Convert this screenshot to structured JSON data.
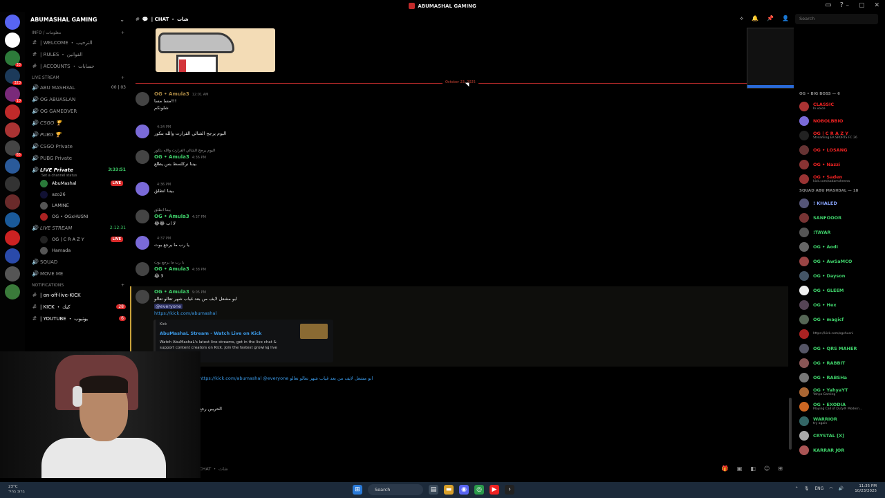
{
  "window": {
    "title": "ABUMASHAL GAMING",
    "search_placeholder": "Search"
  },
  "server": {
    "name": "ABUMASHAL GAMING"
  },
  "categories": {
    "info": "INFO / معلومات",
    "live": "LIVE STREAM",
    "notifications": "NOTIFICATIONS"
  },
  "channels": [
    {
      "label": "| WELCOME ・ الترحيب",
      "icon": "👋"
    },
    {
      "label": "| RULES ・ القوانين",
      "icon": "📄"
    },
    {
      "label": "| ACCOUNTS ・ حسابات",
      "icon": "🔗"
    },
    {
      "label": "ABU MASH3AL",
      "meta": "00 | 03"
    },
    {
      "label": "OG ABUASLAN",
      "meta": ""
    },
    {
      "label": "OG GAMEOVER",
      "meta": ""
    },
    {
      "label": "CSGO 🏆",
      "meta": ""
    },
    {
      "label": "PUBG 🏆",
      "meta": ""
    },
    {
      "label": "CSGO Private",
      "meta": ""
    },
    {
      "label": "PUBG Private",
      "meta": ""
    },
    {
      "label": "LIVE Private",
      "meta": "3:33:51",
      "status": "Set a channel status"
    },
    {
      "label": "LIVE STREAM",
      "meta": "2:12:31"
    },
    {
      "label": "SQUAD",
      "meta": ""
    },
    {
      "label": "MOVE ME",
      "meta": ""
    },
    {
      "label": "| on-off-live-KICK",
      "meta": ""
    },
    {
      "label": "| KICK ・ كيك",
      "meta": "28"
    },
    {
      "label": "| YOUTUBE ・ يوتيوب",
      "meta": "6"
    }
  ],
  "voice_users": [
    {
      "name": "AbuMashal",
      "live": "LIVE"
    },
    {
      "name": "azo26",
      "live": ""
    },
    {
      "name": "LAMINE",
      "live": ""
    },
    {
      "name": "OG • OGxHUSNI",
      "live": ""
    },
    {
      "name": "OG | C R A Z Y",
      "live": "LIVE"
    },
    {
      "name": "Hamada",
      "live": ""
    }
  ],
  "channel_header": {
    "name": "| CHAT ・ شات"
  },
  "divider_label": "October 23, 2025",
  "messages": [
    {
      "name": "OG • Amula3",
      "time": "12:01 AM",
      "lines": [
        "مسا مسا!!!",
        "شلونكم"
      ]
    },
    {
      "name": "",
      "time": "4:34 PM",
      "lines": [
        "اليوم يرجح الشالي القرارت والله بتكور"
      ]
    },
    {
      "name": "OG • Amula3",
      "time": "4:36 PM",
      "lines": [
        "بيننا نركلسط بس يطلع"
      ]
    },
    {
      "name": "",
      "time": "4:36 PM",
      "lines": [
        "بيننا انطلق"
      ]
    },
    {
      "name": "OG • Amula3",
      "time": "4:37 PM",
      "lines": [
        "😂😂 لا اب"
      ]
    },
    {
      "name": "",
      "time": "4:37 PM",
      "lines": [
        "يا رب ما يرجع بوت"
      ]
    },
    {
      "name": "OG • Amula3",
      "time": "4:38 PM",
      "lines": [
        "😂 لا"
      ]
    },
    {
      "name": "OG • Amula3",
      "time": "9:05 PM",
      "lines": [
        "ابو مشعل لايف من بعد غياب شهر تعالو تعالو",
        "@everyone",
        "https://kick.com/abumashal"
      ]
    }
  ],
  "kick_embed": {
    "provider": "Kick",
    "title": "AbuMashaL Stream - Watch Live on Kick",
    "desc": "Watch AbuMashaL's latest live streams, get in the live chat & support content creators on Kick. Join the fastest growing live streaming platform!"
  },
  "tail_messages": [
    {
      "text": "https://kick.com/abumashal @everyone ابو مشعل لايف من بعد غياب شهر تعالو تعالو"
    },
    {
      "text": "الحربين رجع"
    }
  ],
  "composer_placeholder": "CHAT ・ شات",
  "members": {
    "group1": "OG • BIG BOSS — 6",
    "group2": "SQUAD ABU MASH3AL — 18",
    "list1": [
      {
        "name": "CLASSIC",
        "sub": "In voice"
      },
      {
        "name": "NOBOLBBIO",
        "sub": ""
      },
      {
        "name": "OG | C R A Z Y",
        "sub": "Streaming EA SPORTS FC 26"
      },
      {
        "name": "OG • LOSANG",
        "sub": ""
      },
      {
        "name": "OG • Nazzi",
        "sub": ""
      },
      {
        "name": "OG • Saden",
        "sub": "kick.com/sadamshenna"
      }
    ],
    "list2": [
      {
        "name": "! KHALED",
        "sub": ""
      },
      {
        "name": "SANFOOOR",
        "sub": ""
      },
      {
        "name": "!TAYAR",
        "sub": ""
      },
      {
        "name": "OG • Aodi",
        "sub": ""
      },
      {
        "name": "OG • AwSaMCO",
        "sub": ""
      },
      {
        "name": "OG • Dayson",
        "sub": ""
      },
      {
        "name": "OG • GLEEM",
        "sub": ""
      },
      {
        "name": "OG • Hex",
        "sub": ""
      },
      {
        "name": "OG • magicf",
        "sub": ""
      },
      {
        "name": "",
        "sub": "https://kick.com/ogxhusni"
      },
      {
        "name": "OG • QRS MAHER",
        "sub": ""
      },
      {
        "name": "OG • RABBIT",
        "sub": ""
      },
      {
        "name": "OG • RABSHa",
        "sub": ""
      },
      {
        "name": "OG • YahyaYT",
        "sub": "Yahya Gaming"
      },
      {
        "name": "OG • EXODIA",
        "sub": "Playing Call of Duty® Modern..."
      },
      {
        "name": "WARRIOR",
        "sub": "try again"
      },
      {
        "name": "CRYSTAL [X]",
        "sub": ""
      },
      {
        "name": "KARRAR JOR",
        "sub": ""
      }
    ]
  },
  "taskbar": {
    "weather": "23°C",
    "weather_sub": "ברוב בהיר",
    "search": "Search",
    "lang": "ENG",
    "time": "11:35 PM",
    "date": "10/23/2025"
  }
}
